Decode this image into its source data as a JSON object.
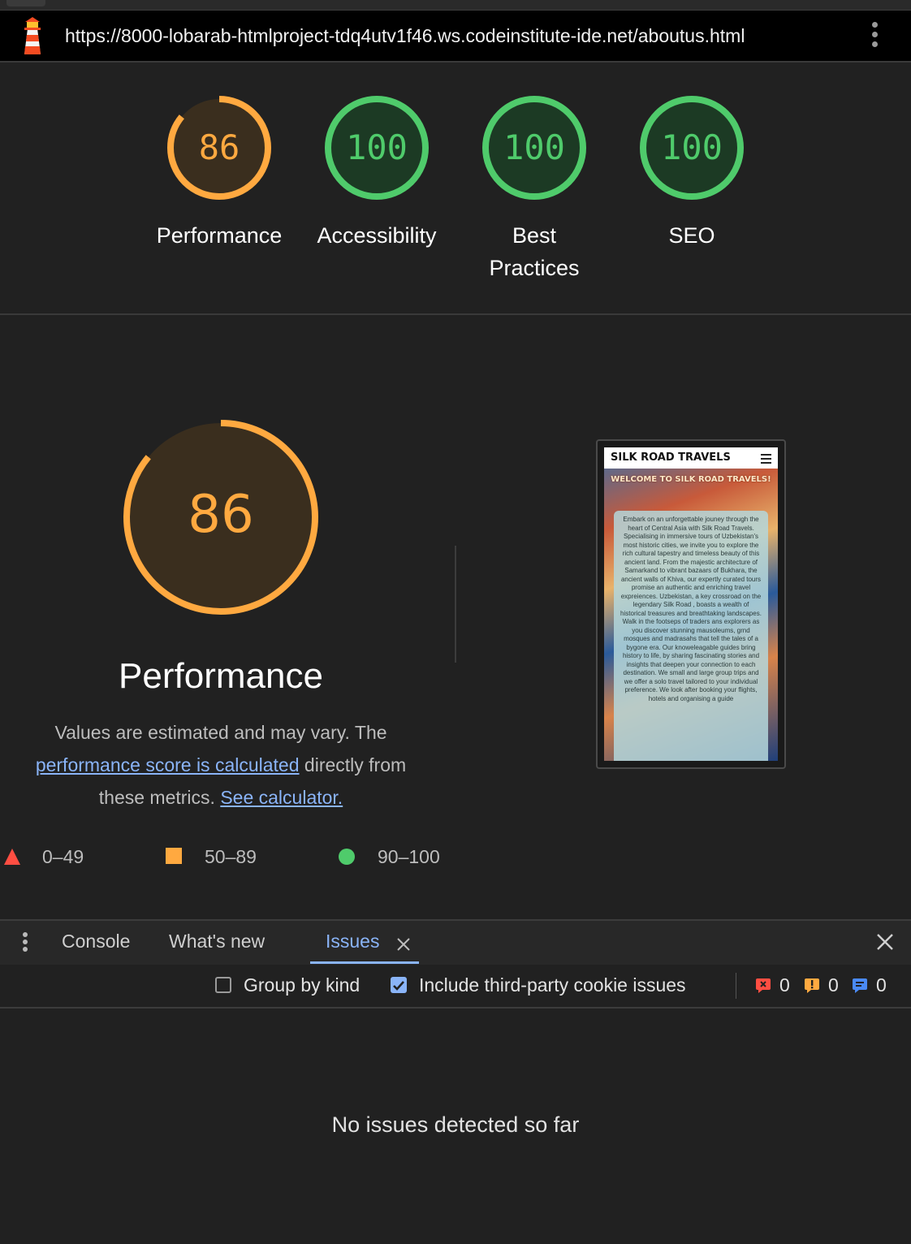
{
  "browser": {
    "url": "https://8000-lobarab-htmlproject-tdq4utv1f46.ws.codeinstitute-ide.net/aboutus.html"
  },
  "scores": [
    {
      "label": "Performance",
      "value": "86",
      "score": 0.86,
      "color": "#ffa940"
    },
    {
      "label": "Accessibility",
      "value": "100",
      "score": 1.0,
      "color": "#4fcb6b"
    },
    {
      "label": "Best Practices",
      "value": "100",
      "score": 1.0,
      "color": "#4fcb6b"
    },
    {
      "label": "SEO",
      "value": "100",
      "score": 1.0,
      "color": "#4fcb6b"
    }
  ],
  "performance": {
    "score": "86",
    "fraction": 0.86,
    "title": "Performance",
    "desc_text1": "Values are estimated and may vary. The",
    "desc_link1": "performance score is calculated",
    "desc_text2": "directly from these metrics.",
    "desc_link2": "See calculator."
  },
  "legend": [
    {
      "range": "0–49",
      "shape": "triangle",
      "color": "#ff4e42"
    },
    {
      "range": "50–89",
      "shape": "square",
      "color": "#ffa940"
    },
    {
      "range": "90–100",
      "shape": "circle",
      "color": "#4fcb6b"
    }
  ],
  "screenshot": {
    "brand": "SILK ROAD TRAVELS",
    "welcome": "WELCOME TO SILK ROAD TRAVELS!",
    "body": "Embark on an unforgettable jouney through the heart of Central Asia with Silk Road Travels. Specialising in immersive tours of Uzbekistan's most historic cities, we invite you to explore the rich cultural tapestry and timeless beauty of this ancient land. From the majestic architecture of Samarkand to vibrant bazaars of Bukhara, the ancient walls of Khiva, our expertly curated tours promise an authentic and enriching travel expreiences. Uzbekistan, a key crossroad on the legendary Silk Road , boasts a wealth of historical treasures and breathtaking landscapes. Walk in the footseps of traders ans explorers as you discover stunning mausoleums, grnd mosques and madrasahs that tell the tales of a bygone era. Our knoweleagable guides bring history to life, by sharing fascinating stories and insights that deepen your connection to each destination. We small and large group trips and we offer a solo travel tailored to your individual preference. We look after booking your flights, hotels and organising a guide"
  },
  "devtools": {
    "tabs": [
      "Console",
      "What's new",
      "Issues"
    ],
    "active_tab": "Issues",
    "group_by_kind": "Group by kind",
    "third_party": "Include third-party cookie issues",
    "counts": {
      "errors": "0",
      "warnings": "0",
      "info": "0"
    },
    "empty_message": "No issues detected so far"
  },
  "icons": {
    "app": "lighthouse-icon",
    "menu": "kebab-menu-icon",
    "close": "close-icon"
  }
}
